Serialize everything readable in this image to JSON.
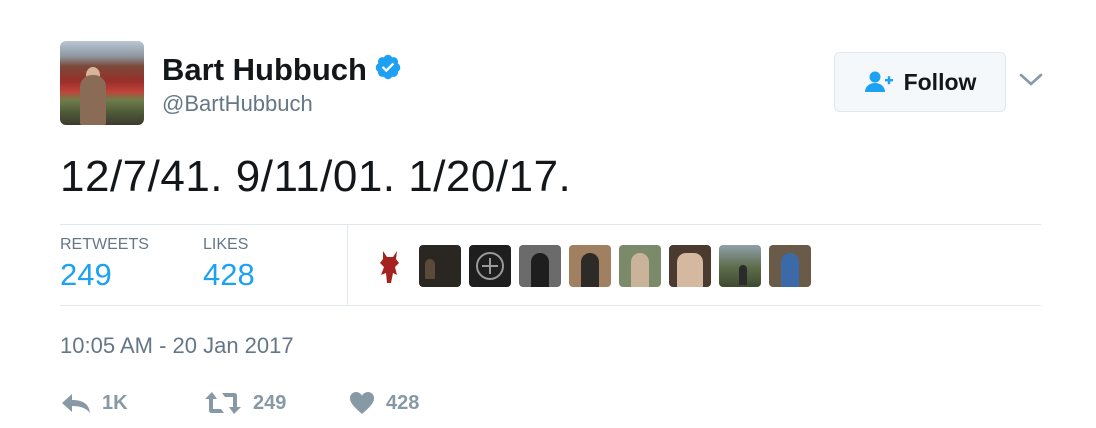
{
  "user": {
    "name": "Bart Hubbuch",
    "handle": "@BartHubbuch",
    "verified": true
  },
  "follow": {
    "label": "Follow"
  },
  "tweet": {
    "text": "12/7/41. 9/11/01. 1/20/17."
  },
  "stats": {
    "retweets_label": "RETWEETS",
    "retweets_value": "249",
    "likes_label": "LIKES",
    "likes_value": "428"
  },
  "timestamp": "10:05 AM - 20 Jan 2017",
  "actions": {
    "reply_count": "1K",
    "retweet_count": "249",
    "like_count": "428"
  },
  "colors": {
    "accent": "#1da1f2",
    "muted": "#657786",
    "icon": "#8899a6"
  },
  "likers": [
    {
      "icon": "red-devil-logo"
    },
    {
      "icon": "dark-photo-avatar"
    },
    {
      "icon": "dark-logo-avatar"
    },
    {
      "icon": "person-avatar"
    },
    {
      "icon": "person-avatar"
    },
    {
      "icon": "person-hat-avatar"
    },
    {
      "icon": "person-avatar"
    },
    {
      "icon": "landscape-avatar"
    },
    {
      "icon": "person-avatar"
    }
  ]
}
